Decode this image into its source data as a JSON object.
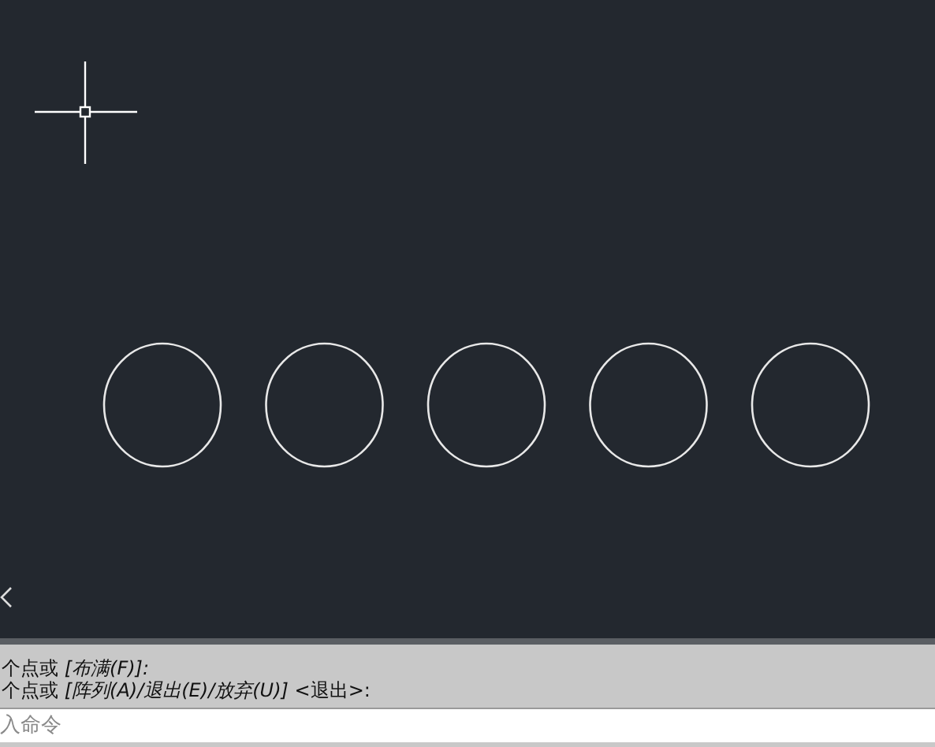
{
  "drawing": {
    "shapes": [
      {
        "kind": "circle"
      },
      {
        "kind": "circle"
      },
      {
        "kind": "circle"
      },
      {
        "kind": "circle"
      },
      {
        "kind": "circle"
      }
    ]
  },
  "command_history": [
    "个点或 *[布满(F)]:*",
    "个点或 *[阵列(A)/退出(E)/放弃(U)]* <退出>:"
  ],
  "command_line": {
    "placeholder": "入命令"
  }
}
